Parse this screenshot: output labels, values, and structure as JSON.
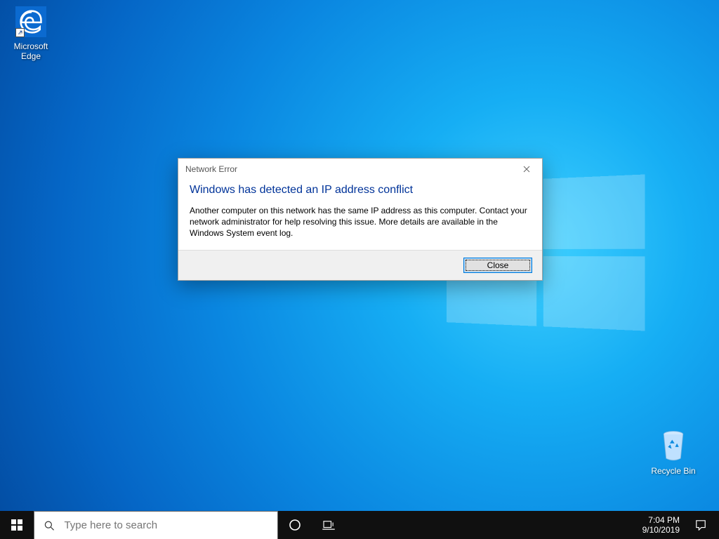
{
  "desktop": {
    "icons": {
      "edge": {
        "label": "Microsoft Edge",
        "name": "edge-icon"
      },
      "recycle": {
        "label": "Recycle Bin",
        "name": "recycle-bin-icon"
      }
    }
  },
  "dialog": {
    "title": "Network Error",
    "headline": "Windows has detected an IP address conflict",
    "message": "Another computer on this network has the same IP address as this computer. Contact your network administrator for help resolving this issue. More details are available in the Windows System event log.",
    "close_button": "Close"
  },
  "taskbar": {
    "search_placeholder": "Type here to search",
    "clock": {
      "time": "7:04 PM",
      "date": "9/10/2019"
    }
  },
  "colors": {
    "accent": "#0078d7",
    "dialog_headline": "#003399"
  }
}
